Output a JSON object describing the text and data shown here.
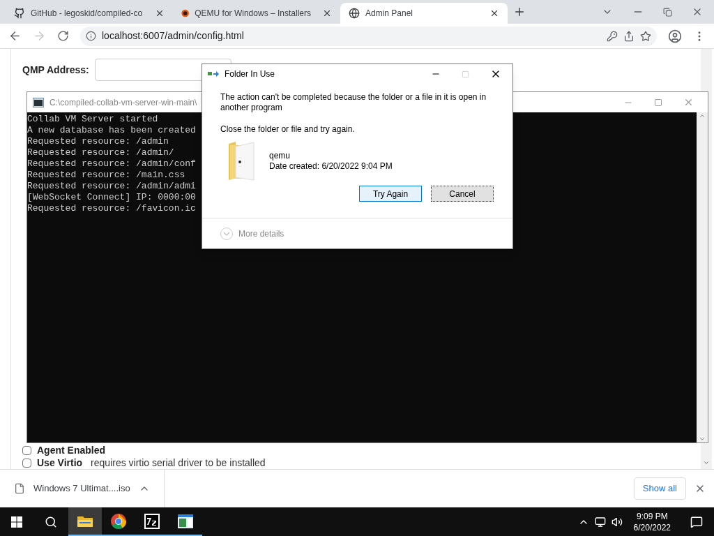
{
  "browser": {
    "tabs": [
      {
        "title": "GitHub - legoskid/compiled-co",
        "kind": "github",
        "selected": false
      },
      {
        "title": "QEMU for Windows – Installers",
        "kind": "qemu",
        "selected": false
      },
      {
        "title": "Admin Panel",
        "kind": "globe",
        "selected": true
      }
    ],
    "forward_disabled": true,
    "address": "localhost:6007/admin/config.html"
  },
  "page": {
    "qmp_label": "QMP Address:",
    "options": [
      {
        "label": "Agent Enabled",
        "checked": false
      },
      {
        "label": "Use Virtio",
        "note": "requires virtio serial driver to be installed",
        "checked": false
      }
    ]
  },
  "console": {
    "title": "C:\\compiled-collab-vm-server-win-main\\",
    "lines": [
      "Collab VM Server started",
      "A new database has been created",
      "Requested resource: /admin",
      "Requested resource: /admin/",
      "Requested resource: /admin/conf",
      "Requested resource: /main.css",
      "Requested resource: /admin/admi",
      "[WebSocket Connect] IP: 0000:00",
      "Requested resource: /favicon.ic"
    ]
  },
  "dialog": {
    "title": "Folder In Use",
    "message": "The action can't be completed because the folder or a file in it is open in another program",
    "instruction": "Close the folder or file and try again.",
    "item": {
      "name": "qemu",
      "date": "Date created: 6/20/2022 9:04 PM"
    },
    "buttons": [
      {
        "label": "Try Again",
        "kind": "default"
      },
      {
        "label": "Cancel",
        "kind": "focused"
      }
    ],
    "details": "More details"
  },
  "downloads": {
    "file": "Windows 7 Ultimat....iso",
    "show_all": "Show all"
  },
  "taskbar": {
    "apps": [
      {
        "kind": "explorer",
        "selected": true
      },
      {
        "kind": "chrome",
        "selected": false
      },
      {
        "kind": "archiver",
        "selected": false
      },
      {
        "kind": "console",
        "selected": false
      }
    ],
    "time": "9:09 PM",
    "date": "6/20/2022"
  }
}
